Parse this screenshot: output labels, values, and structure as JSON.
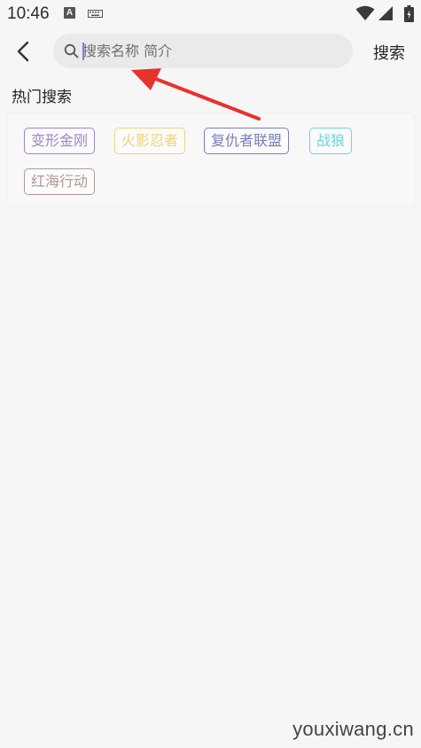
{
  "status_bar": {
    "time": "10:46",
    "notification_icon_letter": "A",
    "icons": [
      "a-notification-icon",
      "keyboard-icon",
      "wifi-icon",
      "signal-icon",
      "battery-icon"
    ]
  },
  "header": {
    "back_icon": "chevron-left-icon",
    "search_icon": "search-icon",
    "search_placeholder": "搜索名称 简介",
    "search_value": "",
    "search_button_label": "搜索"
  },
  "hot_search": {
    "title": "热门搜索",
    "tags": [
      {
        "label": "变形金刚",
        "color": "#9b87c9"
      },
      {
        "label": "火影忍者",
        "color": "#eed27a"
      },
      {
        "label": "复仇者联盟",
        "color": "#7a7fb8"
      },
      {
        "label": "战狼",
        "color": "#6fd3dd"
      },
      {
        "label": "红海行动",
        "color": "#ad9a96"
      }
    ]
  },
  "colors": {
    "background": "#f6f6f6",
    "search_box": "#eaeaea",
    "caret": "#7b7fe8",
    "annotation_arrow": "#e8322c"
  },
  "watermark": "youxiwang.cn"
}
